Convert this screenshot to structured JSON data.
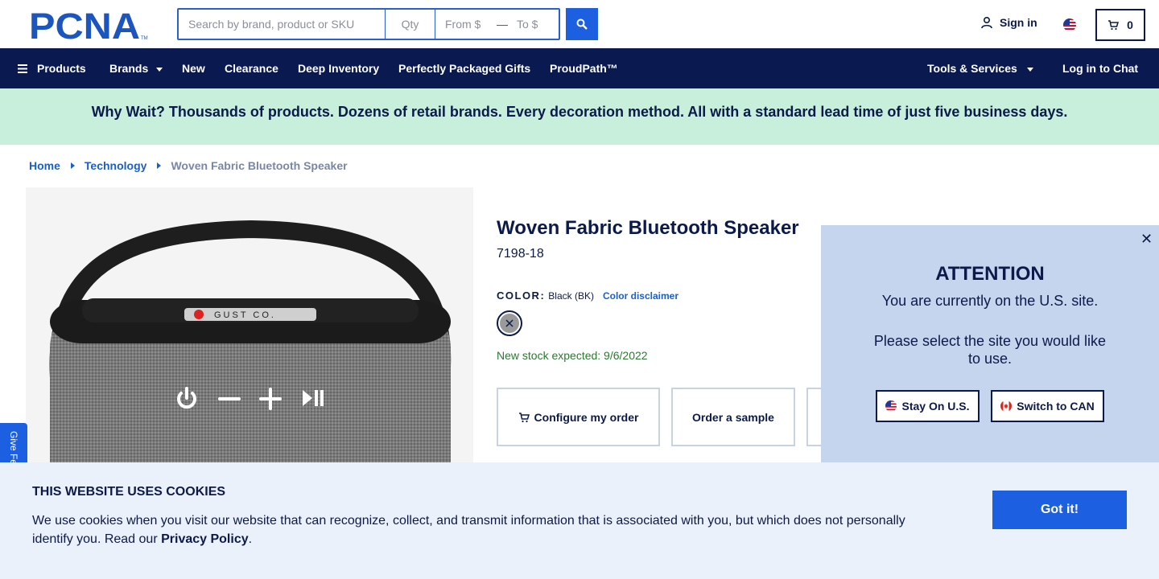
{
  "header": {
    "logo_text": "PCNA",
    "logo_tm": "TM",
    "search_placeholder": "Search by brand, product or SKU",
    "qty_placeholder": "Qty",
    "from_placeholder": "From $",
    "range_dash": "—",
    "to_placeholder": "To $",
    "signin_label": "Sign in",
    "cart_count": "0"
  },
  "nav": {
    "products": "Products",
    "brands": "Brands",
    "new": "New",
    "clearance": "Clearance",
    "deep_inventory": "Deep Inventory",
    "gifts": "Perfectly Packaged Gifts",
    "proudpath": "ProudPath™",
    "tools": "Tools & Services",
    "chat": "Log in to Chat"
  },
  "promo": {
    "text": "Why Wait? Thousands of products. Dozens of retail brands. Every decoration method. All with a standard lead time of just five business days."
  },
  "breadcrumb": {
    "home": "Home",
    "category": "Technology",
    "current": "Woven Fabric Bluetooth Speaker"
  },
  "product": {
    "title": "Woven Fabric Bluetooth Speaker",
    "sku": "7198-18",
    "color_label": "COLOR:",
    "color_value": "Black (BK)",
    "color_disclaimer": "Color disclaimer",
    "stock": "New stock expected: 9/6/2022",
    "imprint": "GUST CO.",
    "configure_btn": "Configure my order",
    "sample_btn": "Order a sample",
    "feedback_tab": "Give Fe"
  },
  "attention": {
    "title": "ATTENTION",
    "line1": "You are currently on the U.S. site.",
    "line2": "Please select the site you would like to use.",
    "stay_btn": "Stay On U.S.",
    "switch_btn": "Switch to CAN"
  },
  "cookie": {
    "title": "THIS WEBSITE USES COOKIES",
    "text": "We use cookies when you visit our website that can recognize, collect, and transmit information that is associated with you, but which does not personally identify you. Read our ",
    "link": "Privacy Policy",
    "end": ".",
    "button": "Got it!"
  },
  "colors": {
    "navy": "#0a1a50",
    "accent_blue": "#1c5fe0",
    "promo_green": "#c7efdc",
    "attention_bg": "#c6d5ee",
    "cookie_bg": "#ebf1fa",
    "stock_green": "#2a7a2e"
  }
}
